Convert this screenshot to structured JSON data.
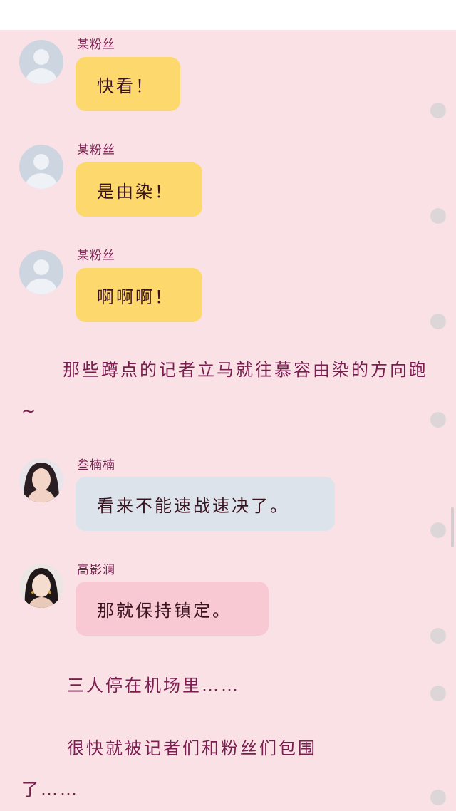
{
  "messages": [
    {
      "name": "某粉丝",
      "text": "快看！"
    },
    {
      "name": "某粉丝",
      "text": "是由染！"
    },
    {
      "name": "某粉丝",
      "text": "啊啊啊！"
    },
    {
      "name": "叁楠楠",
      "text": "看来不能速战速决了。"
    },
    {
      "name": "高影澜",
      "text": "那就保持镇定。"
    }
  ],
  "narration": [
    "那些蹲点的记者立马就往慕容由染的方向跑~",
    "三人停在机场里……",
    "很快就被记者们和粉丝们包围了……"
  ],
  "colors": {
    "background": "#f9e1e6",
    "fan_bubble": "#fdd96d",
    "nannan_bubble": "#dde3ea",
    "yinglan_bubble": "#f8c9d3",
    "narration_text": "#7a1d4f"
  }
}
